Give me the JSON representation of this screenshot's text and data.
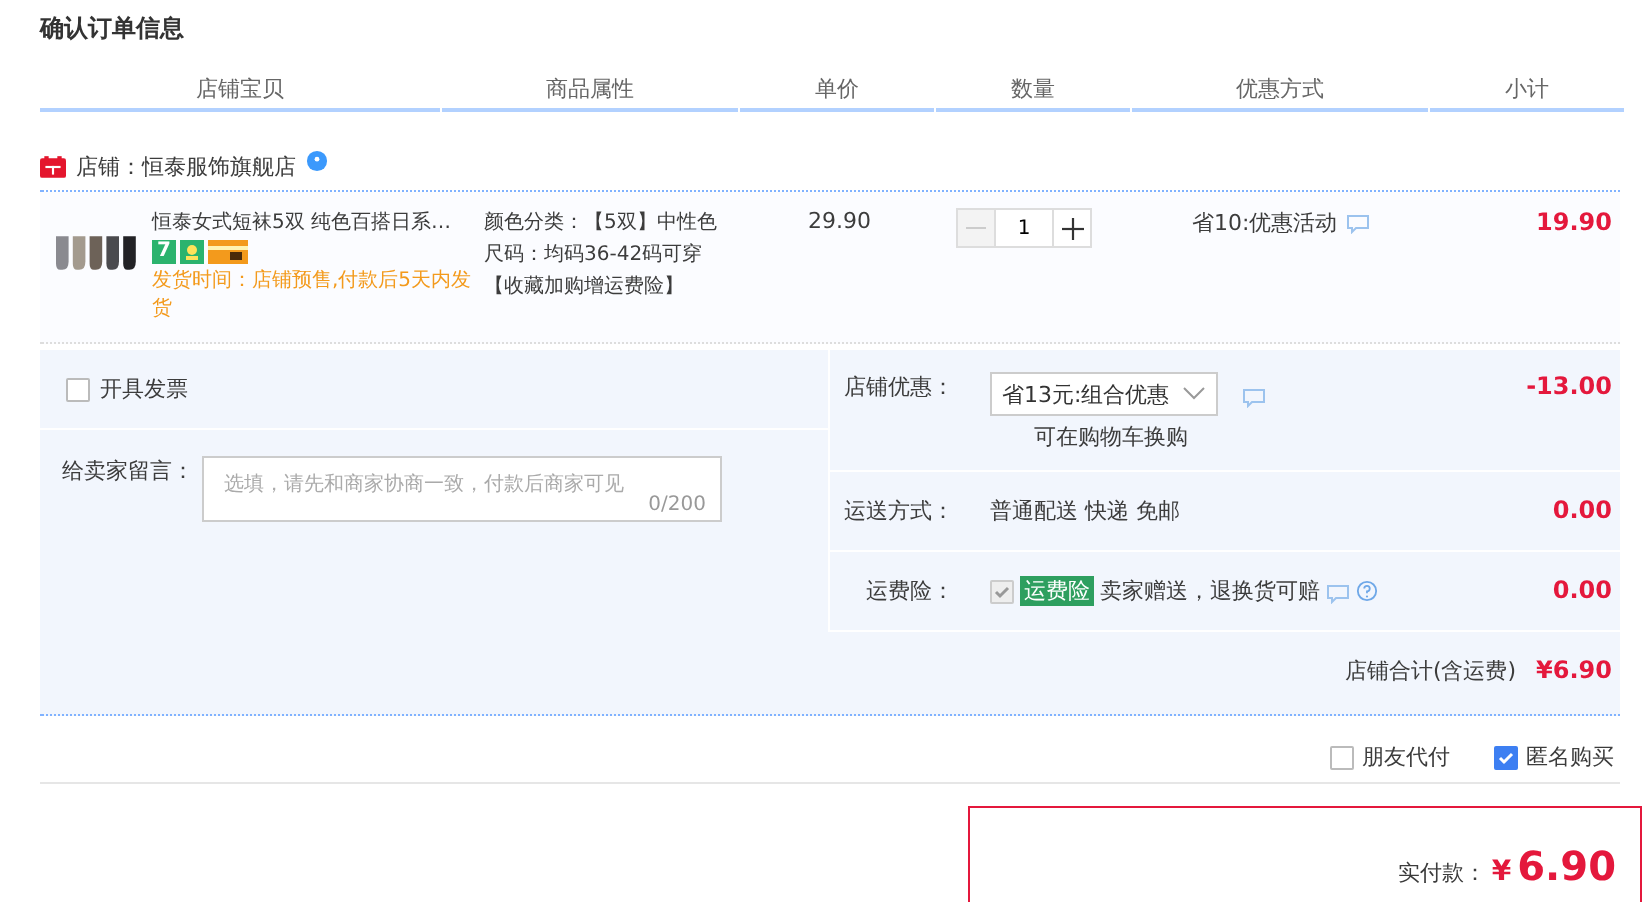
{
  "page_title": "确认订单信息",
  "columns": [
    "店铺宝贝",
    "商品属性",
    "单价",
    "数量",
    "优惠方式",
    "小计"
  ],
  "store": {
    "label": "店铺：恒泰服饰旗舰店"
  },
  "item": {
    "title": "恒泰女式短袜5双 纯色百搭日系…",
    "badge": "7",
    "ship_time": "发货时间：店铺预售,付款后5天内发货",
    "attrs": [
      "颜色分类：【5双】中性色",
      "尺码：均码36-42码可穿【收藏加购增运费险】"
    ],
    "price": "29.90",
    "quantity": "1",
    "minus_disabled": true,
    "promo": "省10:优惠活动",
    "subtotal": "19.90"
  },
  "invoice": {
    "label": "开具发票",
    "checked": false
  },
  "message": {
    "label": "给卖家留言：",
    "placeholder": "选填，请先和商家协商一致，付款后商家可见",
    "counter": "0/200"
  },
  "fees": [
    {
      "kind": "select",
      "label": "店铺优惠：",
      "value": "省13元:组合优惠",
      "note": "可在购物车换购",
      "amount": "-13.00"
    },
    {
      "kind": "text",
      "label": "运送方式：",
      "value": "普通配送 快递 免邮",
      "amount": "0.00"
    },
    {
      "kind": "insurance",
      "label": "运费险：",
      "tag": "运费险",
      "value": "卖家赠送，退换货可赔",
      "checked": true,
      "amount": "0.00"
    }
  ],
  "store_total": {
    "label": "店铺合计(含运费)",
    "amount": "¥6.90"
  },
  "options": [
    {
      "label": "朋友代付",
      "checked": false
    },
    {
      "label": "匿名购买",
      "checked": true
    }
  ],
  "payment": {
    "label": "实付款：",
    "currency": "¥",
    "amount": "6.90"
  }
}
